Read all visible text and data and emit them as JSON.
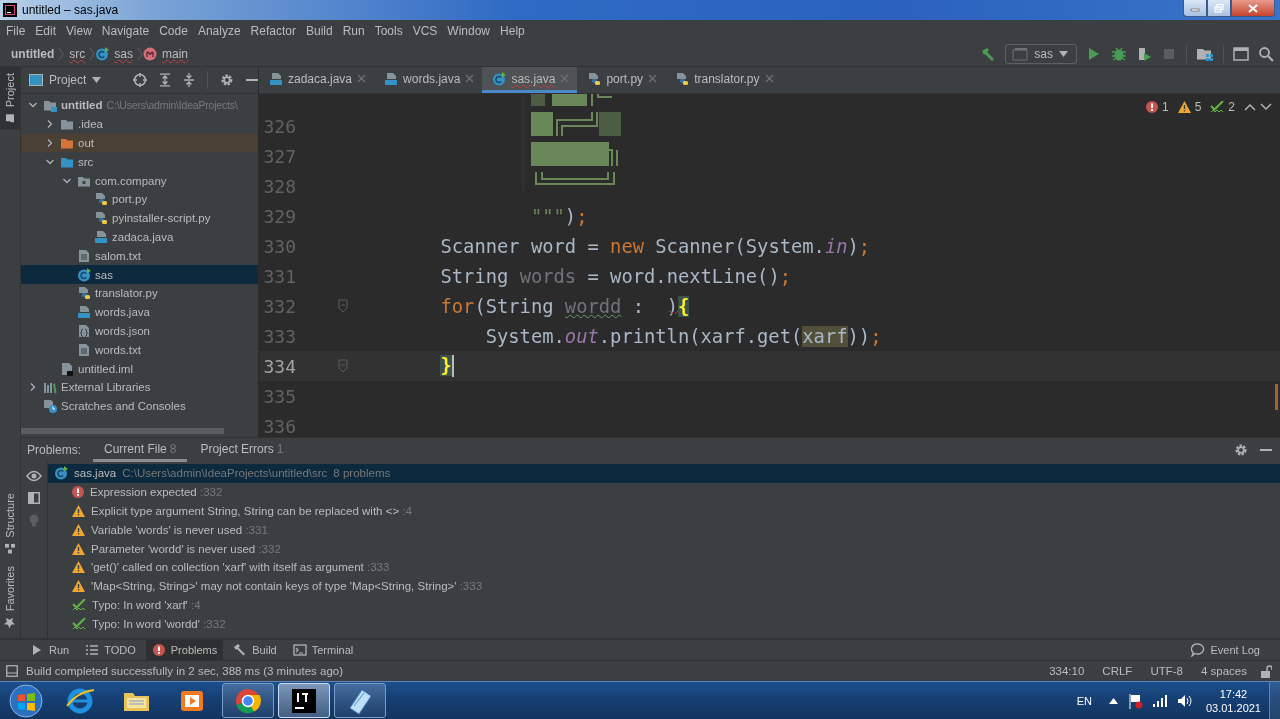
{
  "window": {
    "title": "untitled – sas.java"
  },
  "menu": [
    "File",
    "Edit",
    "View",
    "Navigate",
    "Code",
    "Analyze",
    "Refactor",
    "Build",
    "Run",
    "Tools",
    "VCS",
    "Window",
    "Help"
  ],
  "breadcrumbs": [
    {
      "label": "untitled",
      "kind": "project"
    },
    {
      "label": "src",
      "kind": "folder"
    },
    {
      "label": "sas",
      "kind": "class"
    },
    {
      "label": "main",
      "kind": "method"
    }
  ],
  "toolbar": {
    "run_config": "sas",
    "buttons": [
      {
        "kind": "run",
        "disabled": false
      },
      {
        "kind": "debug",
        "disabled": false
      },
      {
        "kind": "coverage",
        "disabled": false
      },
      {
        "kind": "stop",
        "disabled": true
      }
    ]
  },
  "side_tabs": [
    {
      "label": "Project",
      "kind": "project",
      "selected": true
    },
    {
      "label": "Structure",
      "kind": "structure",
      "selected": false
    },
    {
      "label": "Favorites",
      "kind": "favorites",
      "selected": false
    }
  ],
  "project_panel": {
    "title": "Project",
    "tree": [
      {
        "label": "untitled",
        "path": "C:\\Users\\admin\\IdeaProjects\\",
        "kind": "module",
        "expanded": true,
        "selected": false,
        "children": [
          {
            "label": ".idea",
            "kind": "folder",
            "expanded": false,
            "selected": false
          },
          {
            "label": "out",
            "kind": "folder-excluded",
            "expanded": false,
            "selected": false
          },
          {
            "label": "src",
            "kind": "folder-source",
            "expanded": true,
            "selected": false,
            "children": [
              {
                "label": "com.company",
                "kind": "package",
                "expanded": true,
                "selected": false,
                "children": [
                  {
                    "label": "port.py",
                    "kind": "python",
                    "selected": false
                  },
                  {
                    "label": "pyinstaller-script.py",
                    "kind": "python",
                    "selected": false
                  },
                  {
                    "label": "zadaca.java",
                    "kind": "java",
                    "selected": false
                  }
                ]
              },
              {
                "label": "salom.txt",
                "kind": "text",
                "selected": false
              },
              {
                "label": "sas",
                "kind": "class",
                "selected": true
              },
              {
                "label": "translator.py",
                "kind": "python",
                "selected": false
              },
              {
                "label": "words.java",
                "kind": "java",
                "selected": false
              },
              {
                "label": "words.json",
                "kind": "json",
                "selected": false
              },
              {
                "label": "words.txt",
                "kind": "text",
                "selected": false
              }
            ]
          },
          {
            "label": "untitled.iml",
            "kind": "iml",
            "selected": false
          }
        ]
      },
      {
        "label": "External Libraries",
        "kind": "libraries",
        "expanded": false,
        "selected": false
      },
      {
        "label": "Scratches and Consoles",
        "kind": "scratches",
        "selected": false
      }
    ]
  },
  "editor": {
    "tabs": [
      {
        "label": "zadaca.java",
        "kind": "java",
        "selected": false
      },
      {
        "label": "words.java",
        "kind": "java",
        "selected": false
      },
      {
        "label": "sas.java",
        "kind": "class",
        "selected": true
      },
      {
        "label": "port.py",
        "kind": "python",
        "selected": false
      },
      {
        "label": "translator.py",
        "kind": "python",
        "selected": false
      }
    ],
    "inspections": {
      "errors": "1",
      "warnings": "5",
      "typos": "2"
    },
    "lines": [
      {
        "number": "326",
        "current": false
      },
      {
        "number": "327",
        "current": false
      },
      {
        "number": "328",
        "current": false
      },
      {
        "number": "329",
        "current": false,
        "tokens": [
          {
            "text": "                \"\"\"",
            "kind": "string"
          },
          {
            "text": ")",
            "kind": "plain"
          },
          {
            "text": ";",
            "kind": "punct"
          }
        ]
      },
      {
        "number": "330",
        "current": false,
        "tokens": [
          {
            "text": "        Scanner word = ",
            "kind": "plain"
          },
          {
            "text": "new",
            "kind": "keyword"
          },
          {
            "text": " Scanner(System.",
            "kind": "plain"
          },
          {
            "text": "in",
            "kind": "static"
          },
          {
            "text": ")",
            "kind": "plain"
          },
          {
            "text": ";",
            "kind": "punct"
          }
        ]
      },
      {
        "number": "331",
        "current": false,
        "tokens": [
          {
            "text": "        String ",
            "kind": "plain"
          },
          {
            "text": "words",
            "kind": "unused"
          },
          {
            "text": " = word.nextLine()",
            "kind": "plain"
          },
          {
            "text": ";",
            "kind": "punct"
          }
        ]
      },
      {
        "number": "332",
        "current": false,
        "fold": true,
        "tokens": [
          {
            "text": "        for",
            "kind": "keyword"
          },
          {
            "text": "(String ",
            "kind": "plain"
          },
          {
            "text": "wordd",
            "kind": "unused_typo"
          },
          {
            "text": " :",
            "kind": "plain"
          },
          {
            "text": "  )",
            "kind": "error_gap"
          },
          {
            "text": "{",
            "kind": "brace"
          }
        ]
      },
      {
        "number": "333",
        "current": false,
        "tokens": [
          {
            "text": "            System.",
            "kind": "plain"
          },
          {
            "text": "out",
            "kind": "static"
          },
          {
            "text": ".println(xarf.get(",
            "kind": "plain"
          },
          {
            "text": "xarf",
            "kind": "match"
          },
          {
            "text": "))",
            "kind": "plain"
          },
          {
            "text": ";",
            "kind": "punct"
          }
        ]
      },
      {
        "number": "334",
        "current": true,
        "fold": true,
        "tokens": [
          {
            "text": "        }",
            "kind": "brace"
          }
        ]
      },
      {
        "number": "335",
        "current": false
      },
      {
        "number": "336",
        "current": false
      }
    ]
  },
  "problems": {
    "label": "Problems:",
    "tabs": [
      {
        "label": "Current File",
        "count": "8",
        "selected": true
      },
      {
        "label": "Project Errors",
        "count": "1",
        "selected": false
      }
    ],
    "file": {
      "name": "sas.java",
      "path": "C:\\Users\\admin\\IdeaProjects\\untitled\\src",
      "count": "8 problems",
      "selected": true
    },
    "items": [
      {
        "kind": "error",
        "text": "Expression expected",
        "line": ":332"
      },
      {
        "kind": "warning",
        "text": "Explicit type argument String, String can be replaced with <>",
        "line": ":4"
      },
      {
        "kind": "warning",
        "text": "Variable 'words' is never used",
        "line": ":331"
      },
      {
        "kind": "warning",
        "text": "Parameter 'wordd' is never used",
        "line": ":332"
      },
      {
        "kind": "warning",
        "text": "'get()' called on collection 'xarf' with itself as argument",
        "line": ":333"
      },
      {
        "kind": "warning",
        "text": "'Map<String, String>' may not contain keys of type 'Map<String, String>'",
        "line": ":333"
      },
      {
        "kind": "typo",
        "text": "Typo: In word 'xarf'",
        "line": ":4"
      },
      {
        "kind": "typo",
        "text": "Typo: In word 'wordd'",
        "line": ":332"
      }
    ]
  },
  "tool_tabs": [
    {
      "label": "Run",
      "kind": "run",
      "selected": false
    },
    {
      "label": "TODO",
      "kind": "todo",
      "selected": false
    },
    {
      "label": "Problems",
      "kind": "problems",
      "selected": true
    },
    {
      "label": "Build",
      "kind": "build",
      "selected": false
    },
    {
      "label": "Terminal",
      "kind": "terminal",
      "selected": false
    }
  ],
  "event_log": "Event Log",
  "status_bar": {
    "message": "Build completed successfully in 2 sec, 388 ms (3 minutes ago)",
    "position": "334:10",
    "line_separator": "CRLF",
    "encoding": "UTF-8",
    "indent": "4 spaces"
  },
  "taskbar": {
    "apps": [
      {
        "kind": "browser",
        "running": false,
        "selected": false
      },
      {
        "kind": "files",
        "running": false,
        "selected": false
      },
      {
        "kind": "media",
        "running": false,
        "selected": false
      },
      {
        "kind": "chrome",
        "running": true,
        "selected": false
      },
      {
        "kind": "ide",
        "running": true,
        "selected": true
      },
      {
        "kind": "notes",
        "running": true,
        "selected": false
      }
    ],
    "language": "EN",
    "time": "17:42",
    "date": "03.01.2021"
  }
}
